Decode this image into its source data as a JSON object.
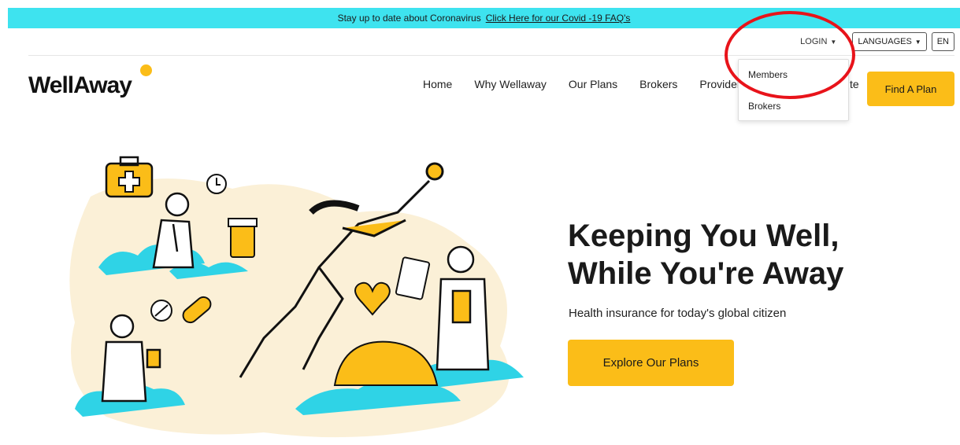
{
  "banner": {
    "text": "Stay up to date about Coronavirus",
    "link": "Click Here for our Covid -19 FAQ's"
  },
  "utility": {
    "login": "LOGIN",
    "languages": "LANGUAGES",
    "lang_code": "EN"
  },
  "login_menu": {
    "items": [
      "Members",
      "Brokers"
    ]
  },
  "header": {
    "logo": "WellAway",
    "nav": [
      "Home",
      "Why Wellaway",
      "Our Plans",
      "Brokers",
      "Providers"
    ],
    "nav_partial": "te",
    "cta": "Find A Plan"
  },
  "hero": {
    "title_line1": "Keeping You Well,",
    "title_line2": "While You're Away",
    "subtitle": "Health insurance for today's global citizen",
    "button": "Explore Our Plans"
  },
  "colors": {
    "banner": "#3ee3ef",
    "accent": "#fbbd18",
    "annotation": "#e8131a",
    "illustration_cloud": "#2fd3e6",
    "illustration_bg": "#fbf0d7"
  },
  "icons": {
    "caret": "caret-down-icon",
    "logo_dot": "sun-dot-icon"
  }
}
